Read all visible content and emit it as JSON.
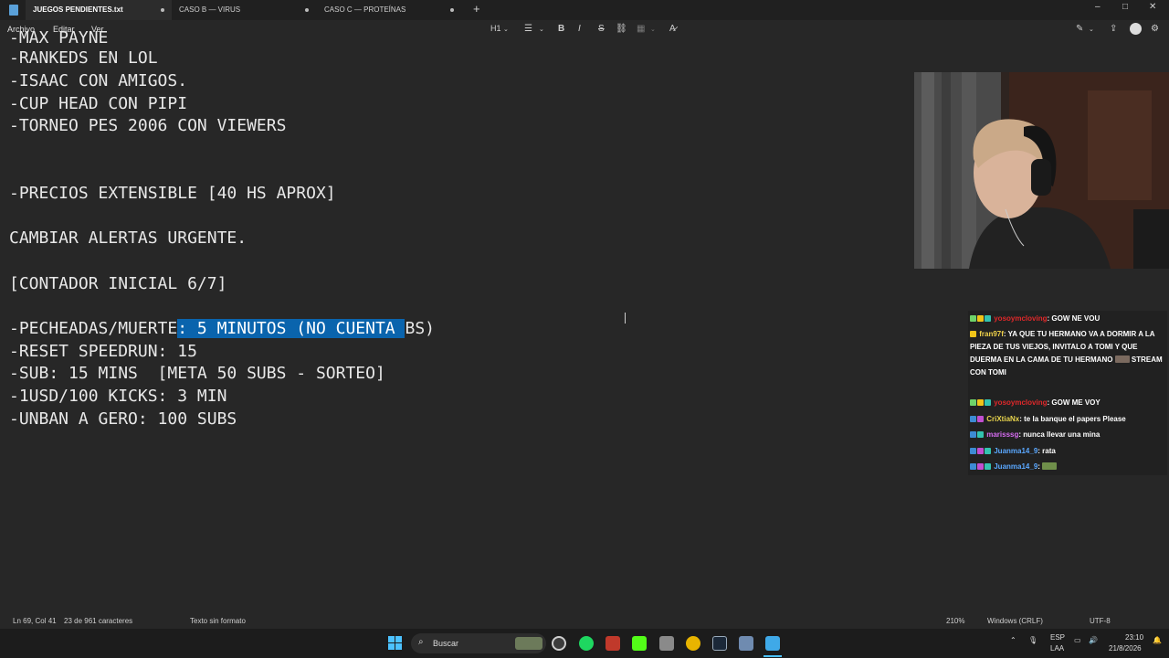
{
  "tabs": [
    {
      "label": "JUEGOS PENDIENTES.txt",
      "active": true
    },
    {
      "label": "CASO B — VIRUS",
      "active": false
    },
    {
      "label": "CASO C — PROTEÍNAS",
      "active": false
    }
  ],
  "menu": {
    "file": "Archivo",
    "edit": "Editar",
    "view": "Ver"
  },
  "toolbar": {
    "heading": "H1",
    "bold": "B",
    "italic": "I",
    "strike": "S"
  },
  "editor": {
    "lines": [
      "-MAX PAYNE",
      "-RANKEDS EN LOL",
      "-ISAAC CON AMIGOS.",
      "-CUP HEAD CON PIPI",
      "-TORNEO PES 2006 CON VIEWERS",
      "-PRECIOS EXTENSIBLE [40 HS APROX]",
      "CAMBIAR ALERTAS URGENTE.",
      "[CONTADOR INICIAL 6/7]",
      "-RESET SPEEDRUN: 15",
      "-SUB: 15 MINS  [META 50 SUBS - SORTEO]",
      "-1USD/100 KICKS: 3 MIN",
      "-UNBAN A GERO: 100 SUBS"
    ],
    "selected_line": {
      "before": "-PECHEADAS/MUERTE",
      "selected": ": 5 MINUTOS (NO CUENTA ",
      "after": "BS)"
    }
  },
  "chat": [
    {
      "user": "yosoymcloving",
      "text": ": GOW NE VOU",
      "color": "#e0282a"
    },
    {
      "user": "fran97f",
      "text": ": YA QUE TU HERMANO VA A DORMIR A LA PIEZA DE TUS VIEJOS, INVITALO A TOMI Y QUE DUERMA EN LA CAMA DE TU HERMANO",
      "extra": "STREAM CON TOMI",
      "color": "#f0d24a"
    },
    {
      "user": "yosoymcloving",
      "text": ": GOW ME VOY",
      "color": "#e0282a"
    },
    {
      "user": "CriXtiaNx",
      "text": ": te la banque el papers Please",
      "color": "#e8d44d"
    },
    {
      "user": "marisssg",
      "text": ": nunca llevar una mina",
      "color": "#d56cf0"
    },
    {
      "user": "Juanma14_9",
      "text": ": rata",
      "color": "#5aa8ff"
    },
    {
      "user": "Juanma14_9",
      "text": ":",
      "color": "#5aa8ff"
    }
  ],
  "status": {
    "position": "Ln 69, Col 41",
    "selection": "23 de 961 caracteres",
    "format": "Texto sin formato",
    "zoom": "210%",
    "line_ending": "Windows (CRLF)",
    "encoding": "UTF-8"
  },
  "taskbar": {
    "search": "Buscar",
    "lang_top": "ESP",
    "lang_bottom": "LAA",
    "time": "23:10",
    "date": "21/8/2026"
  }
}
